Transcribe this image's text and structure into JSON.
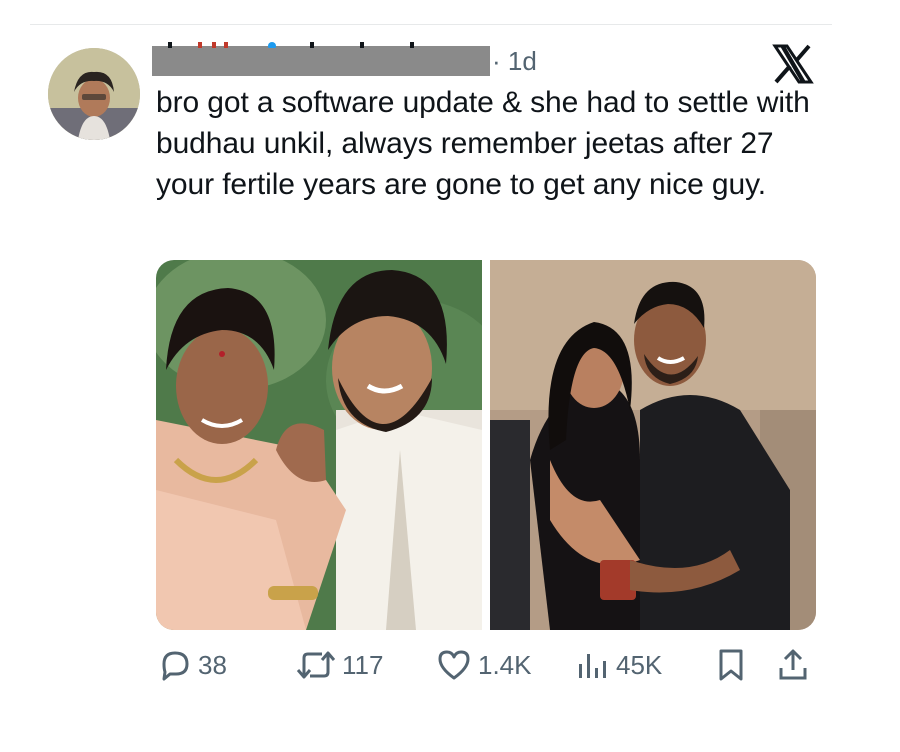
{
  "tweet": {
    "time": "· 1d",
    "text": "bro got a software update & she had to settle with budhau unkil, always remember jeetas after 27 your fertile years are gone to get any nice guy."
  },
  "header": {
    "logo_icon": "x-logo-icon"
  },
  "media": {
    "images": [
      {
        "description_icon": "photo-couple-1"
      },
      {
        "description_icon": "photo-couple-2"
      }
    ]
  },
  "actions": {
    "replies": "38",
    "reposts": "117",
    "likes": "1.4K",
    "views": "45K"
  },
  "colors": {
    "text": "#0f1419",
    "secondary": "#536471",
    "redaction": "#8a8a8a"
  }
}
